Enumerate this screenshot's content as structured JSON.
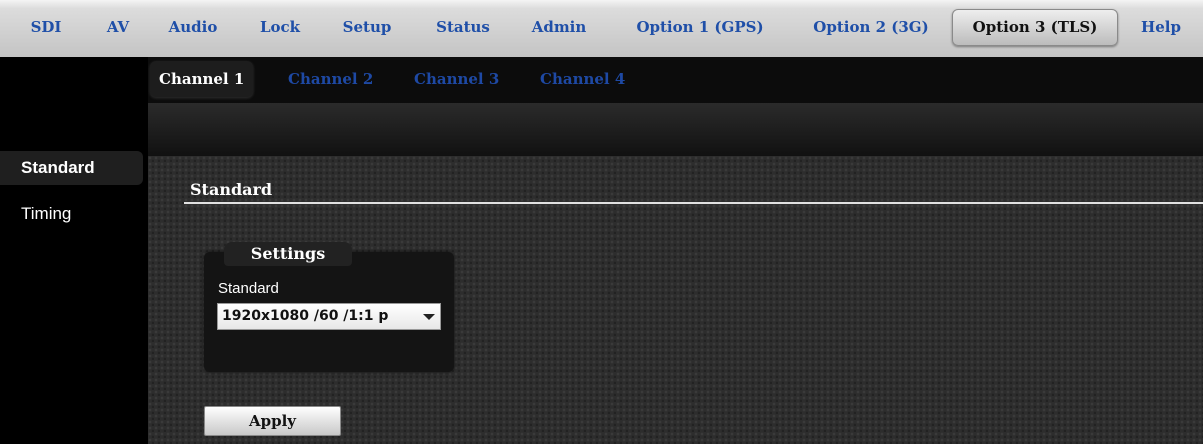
{
  "top_nav": {
    "items": [
      "SDI",
      "AV",
      "Audio",
      "Lock",
      "Setup",
      "Status",
      "Admin",
      "Option 1 (GPS)",
      "Option 2 (3G)",
      "Option 3 (TLS)",
      "Help"
    ],
    "active": "Option 3 (TLS)"
  },
  "sub_nav": {
    "tabs": [
      "Channel 1",
      "Channel 2",
      "Channel 3",
      "Channel 4"
    ],
    "active": "Channel 1"
  },
  "sidebar": {
    "items": [
      "Standard",
      "Timing"
    ],
    "active": "Standard"
  },
  "content": {
    "section_title": "Standard",
    "settings": {
      "title": "Settings",
      "standard_label": "Standard",
      "standard_value": "1920x1080 /60 /1:1 p"
    },
    "apply_label": "Apply"
  },
  "colors": {
    "nav_link": "#1f4fa8",
    "subtab_link": "#1e49a4",
    "content_bg": "#2d2d2d"
  }
}
